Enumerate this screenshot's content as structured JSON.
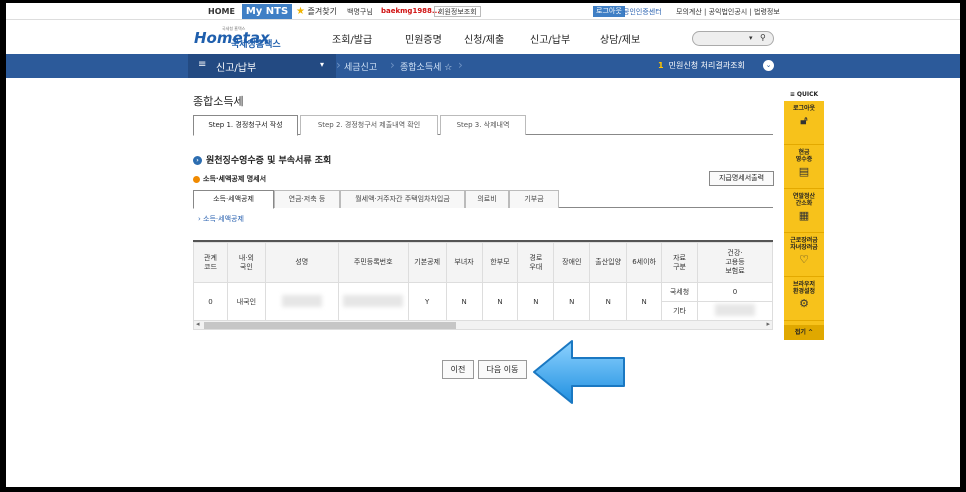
{
  "utilbar": {
    "home": "HOME",
    "mynts": "My NTS",
    "favorites": "즐겨찾기",
    "user_name": "백명구님",
    "user_id": "baekmg1988...",
    "member_info": "회원정보조회",
    "logout": "로그아웃",
    "cert_center": "공인인증센터",
    "right_links": "모의계산 | 공익법인공시 | 법령정보"
  },
  "header": {
    "logo_main": "Hometax",
    "logo_sub": "국세청홈택스",
    "logo_tiny": "국세청 홈택스",
    "gnb": [
      "조회/발급",
      "민원증명",
      "신청/제출",
      "신고/납부",
      "상담/제보"
    ],
    "search_placeholder": ""
  },
  "bluenav": {
    "menu_icon": "menu-icon",
    "title": "신고/납부",
    "crumb1": "세금신고",
    "crumb2": "종합소득세",
    "alert_count": "1",
    "alert_text": "민원신청 처리결과조회"
  },
  "page": {
    "title": "종합소득세",
    "step_tabs": [
      "Step 1. 경정청구서 작성",
      "Step 2. 경정청구서 제출내역 확인",
      "Step 3. 삭제내역"
    ],
    "section_title": "원천징수영수증 및 부속서류 조회",
    "sub_title": "소득·세액공제 명세서",
    "print_button": "지급명세서출력",
    "inner_tabs": [
      "소득·세액공제",
      "연금·저축 등",
      "월세액·거주자간 주택임차차입금",
      "의료비",
      "기부금"
    ],
    "inner_link": "소득·세액공제"
  },
  "table": {
    "headers": [
      "관계\n코드",
      "내·외\n국인",
      "성명",
      "주민등록번호",
      "기본공제",
      "부녀자",
      "한부모",
      "경로\n우대",
      "장애인",
      "출산입양",
      "6세이하",
      "자료\n구분",
      "건강·\n고용등\n보험료"
    ],
    "row": {
      "code": "0",
      "nationality": "내국인",
      "basic": "Y",
      "women": "N",
      "single_parent": "N",
      "elderly": "N",
      "disabled": "N",
      "birth": "N",
      "under6": "N",
      "source1": "국세청",
      "source2": "기타",
      "insurance1": "0"
    }
  },
  "buttons": {
    "prev": "이전",
    "next": "다음 이동"
  },
  "quick": {
    "header": "≡ QUICK",
    "items": [
      {
        "label": "로그아웃",
        "icon": "lock-icon"
      },
      {
        "label": "현금\n영수증",
        "icon": "receipt-icon"
      },
      {
        "label": "연말정산\n간소화",
        "icon": "calc-icon"
      },
      {
        "label": "근로장려금\n자녀장려금",
        "icon": "heart-icon"
      },
      {
        "label": "브라우저\n환경설정",
        "icon": "gear-icon"
      }
    ],
    "fold": "접기 ^"
  },
  "colors": {
    "nav_blue": "#2c5a9a",
    "quick_yellow": "#f7c21b",
    "arrow_blue": "#3aa7f0"
  }
}
